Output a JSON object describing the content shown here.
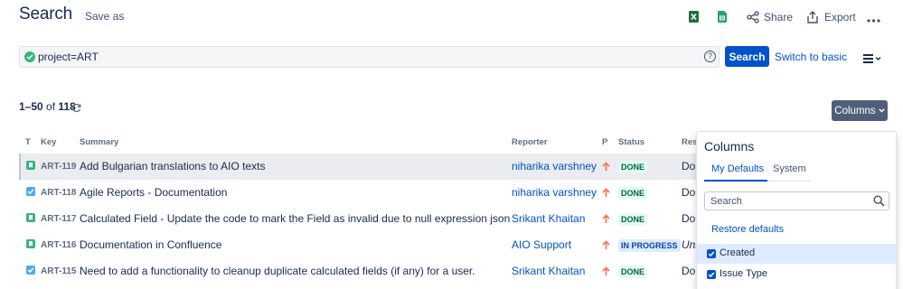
{
  "header": {
    "title": "Search",
    "save_as": "Save as",
    "share": "Share",
    "export": "Export",
    "excel_icon": "excel-icon",
    "sheets_icon": "sheets-icon"
  },
  "query": {
    "value": "project=ART",
    "search_label": "Search",
    "switch_basic": "Switch to basic"
  },
  "results": {
    "range": "1–50",
    "of": "of",
    "total": "118",
    "columns_button": "Columns"
  },
  "table": {
    "headers": {
      "t": "T",
      "key": "Key",
      "summary": "Summary",
      "reporter": "Reporter",
      "p": "P",
      "status": "Status",
      "resolution": "Reso"
    },
    "rows": [
      {
        "type": "story",
        "key": "ART-119",
        "summary": "Add Bulgarian translations to AIO texts",
        "reporter": "niharika varshney",
        "status": "DONE",
        "resolution": "Don"
      },
      {
        "type": "task",
        "key": "ART-118",
        "summary": "Agile Reports - Documentation",
        "reporter": "niharika varshney",
        "status": "DONE",
        "resolution": "Don"
      },
      {
        "type": "story",
        "key": "ART-117",
        "summary": "Calculated Field - Update the code to mark the Field as invalid due to null expression json",
        "reporter": "Srikant Khaitan",
        "status": "DONE",
        "resolution": "Don"
      },
      {
        "type": "story",
        "key": "ART-116",
        "summary": "Documentation in Confluence",
        "reporter": "AIO Support",
        "status": "IN PROGRESS",
        "resolution": "Unr"
      },
      {
        "type": "task",
        "key": "ART-115",
        "summary": "Need to add a functionality to cleanup duplicate calculated fields (if any) for a user.",
        "reporter": "Srikant Khaitan",
        "status": "DONE",
        "resolution": "Don"
      }
    ]
  },
  "columns_panel": {
    "title": "Columns",
    "tab_defaults": "My Defaults",
    "tab_system": "System",
    "search_placeholder": "Search",
    "restore": "Restore defaults",
    "options": [
      "Created",
      "Issue Type"
    ]
  },
  "colors": {
    "primary": "#0052cc",
    "done_bg": "#e3fcef",
    "done_text": "#006644",
    "progress_bg": "#deebff",
    "progress_text": "#0747a6",
    "priority": "#ff7452"
  }
}
